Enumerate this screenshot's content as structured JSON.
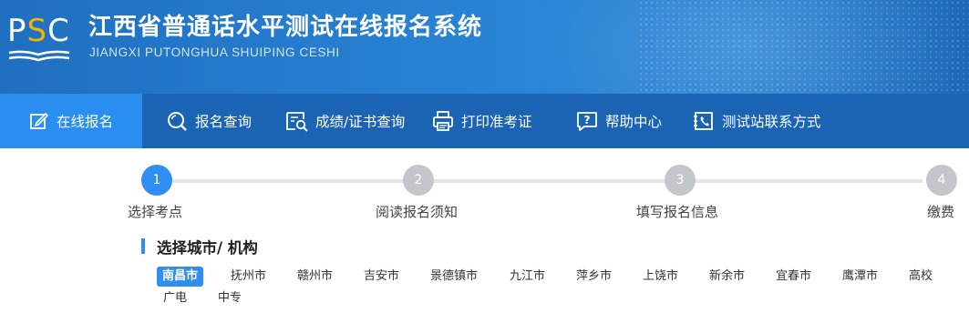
{
  "header": {
    "logo": {
      "p": "P",
      "s": "S",
      "c": "C"
    },
    "title_cn": "江西省普通话水平测试在线报名系统",
    "title_en": "JIANGXI PUTONGHUA SHUIPING CESHI"
  },
  "nav": {
    "items": [
      {
        "label": "在线报名",
        "icon": "edit-icon",
        "active": true
      },
      {
        "label": "报名查询",
        "icon": "search-icon"
      },
      {
        "label": "成绩/证书查询",
        "icon": "certificate-search-icon"
      },
      {
        "label": "打印准考证",
        "icon": "printer-icon"
      },
      {
        "label": "帮助中心",
        "icon": "help-icon"
      },
      {
        "label": "测试站联系方式",
        "icon": "phone-icon"
      }
    ]
  },
  "steps": [
    {
      "num": "1",
      "label": "选择考点",
      "active": true
    },
    {
      "num": "2",
      "label": "阅读报名须知"
    },
    {
      "num": "3",
      "label": "填写报名信息"
    },
    {
      "num": "4",
      "label": "缴费"
    }
  ],
  "section": {
    "title": "选择城市/ 机构",
    "cities": [
      "南昌市",
      "抚州市",
      "赣州市",
      "吉安市",
      "景德镇市",
      "九江市",
      "萍乡市",
      "上饶市",
      "新余市",
      "宜春市",
      "鹰潭市",
      "高校",
      "广电",
      "中专"
    ],
    "selected": "南昌市"
  },
  "colors": {
    "header_blue": "#1f6fc0",
    "nav_blue": "#1a64b3",
    "active_blue": "#2f8ff0",
    "logo_yellow": "#f0b400",
    "inactive_step": "#c3c7cc"
  }
}
